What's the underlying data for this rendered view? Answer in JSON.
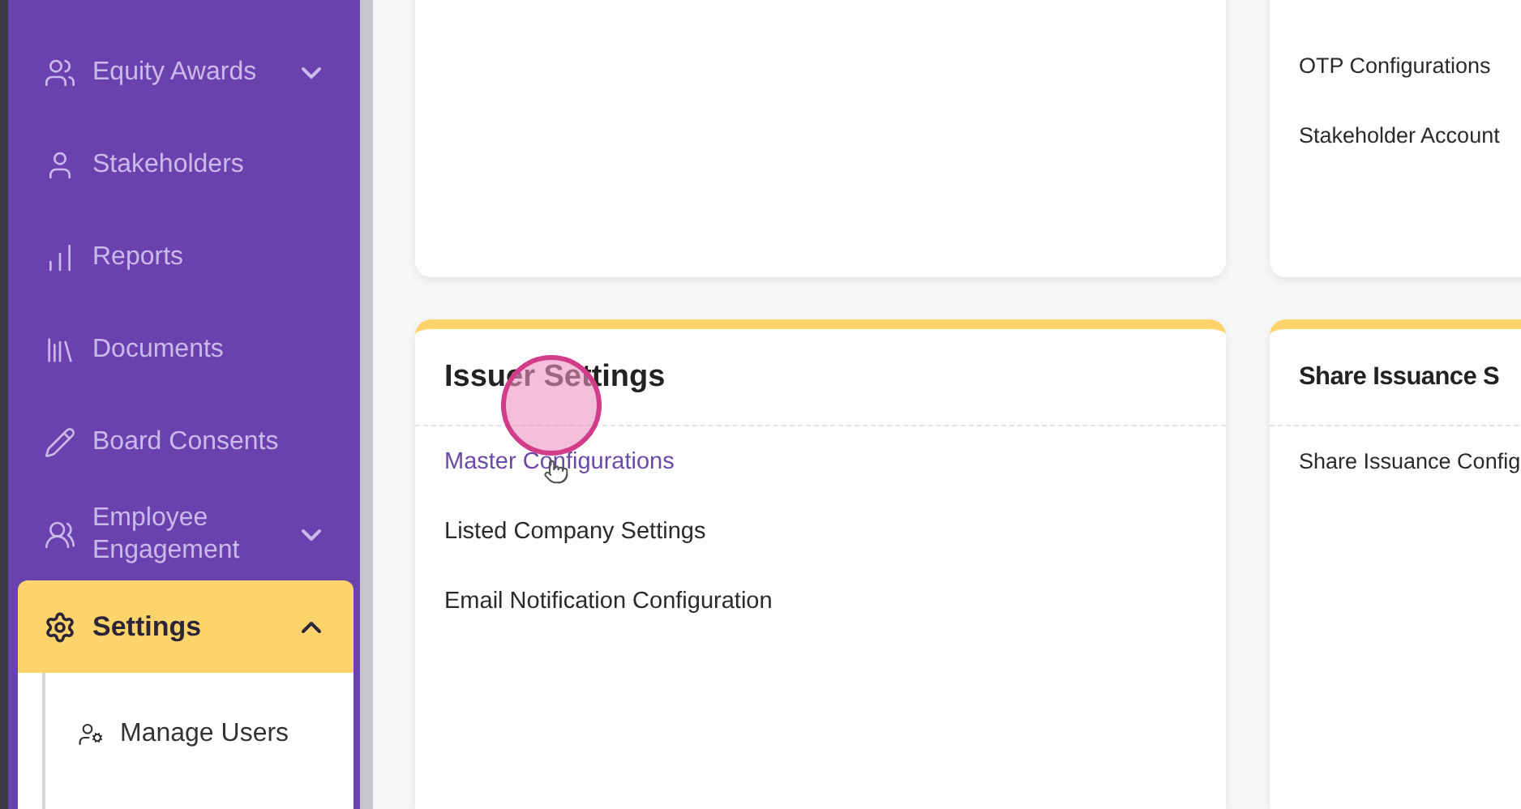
{
  "sidebar": {
    "items": [
      {
        "label": "Equity Awards",
        "expanded": false,
        "selected": false
      },
      {
        "label": "Stakeholders",
        "selected": false
      },
      {
        "label": "Reports",
        "selected": false
      },
      {
        "label": "Documents",
        "selected": false
      },
      {
        "label": "Board Consents",
        "selected": false
      },
      {
        "label": "Employee Engagement",
        "expanded": false,
        "selected": false
      },
      {
        "label": "Settings",
        "expanded": true,
        "selected": true,
        "children": [
          {
            "label": "Manage Users"
          }
        ]
      }
    ]
  },
  "cards": [
    {
      "kind": "blank"
    },
    {
      "kind": "list",
      "items": [
        {
          "label": "OTP Configurations",
          "hovered": false
        },
        {
          "label": "Stakeholder Account",
          "hovered": false
        }
      ]
    },
    {
      "kind": "section",
      "title": "Issuer Settings",
      "items": [
        {
          "label": "Master Configurations",
          "hovered": true
        },
        {
          "label": "Listed Company Settings",
          "hovered": false
        },
        {
          "label": "Email Notification Configuration",
          "hovered": false
        }
      ]
    },
    {
      "kind": "section",
      "title": "Share Issuance S",
      "items": [
        {
          "label": "Share Issuance Config",
          "hovered": false
        }
      ]
    }
  ]
}
